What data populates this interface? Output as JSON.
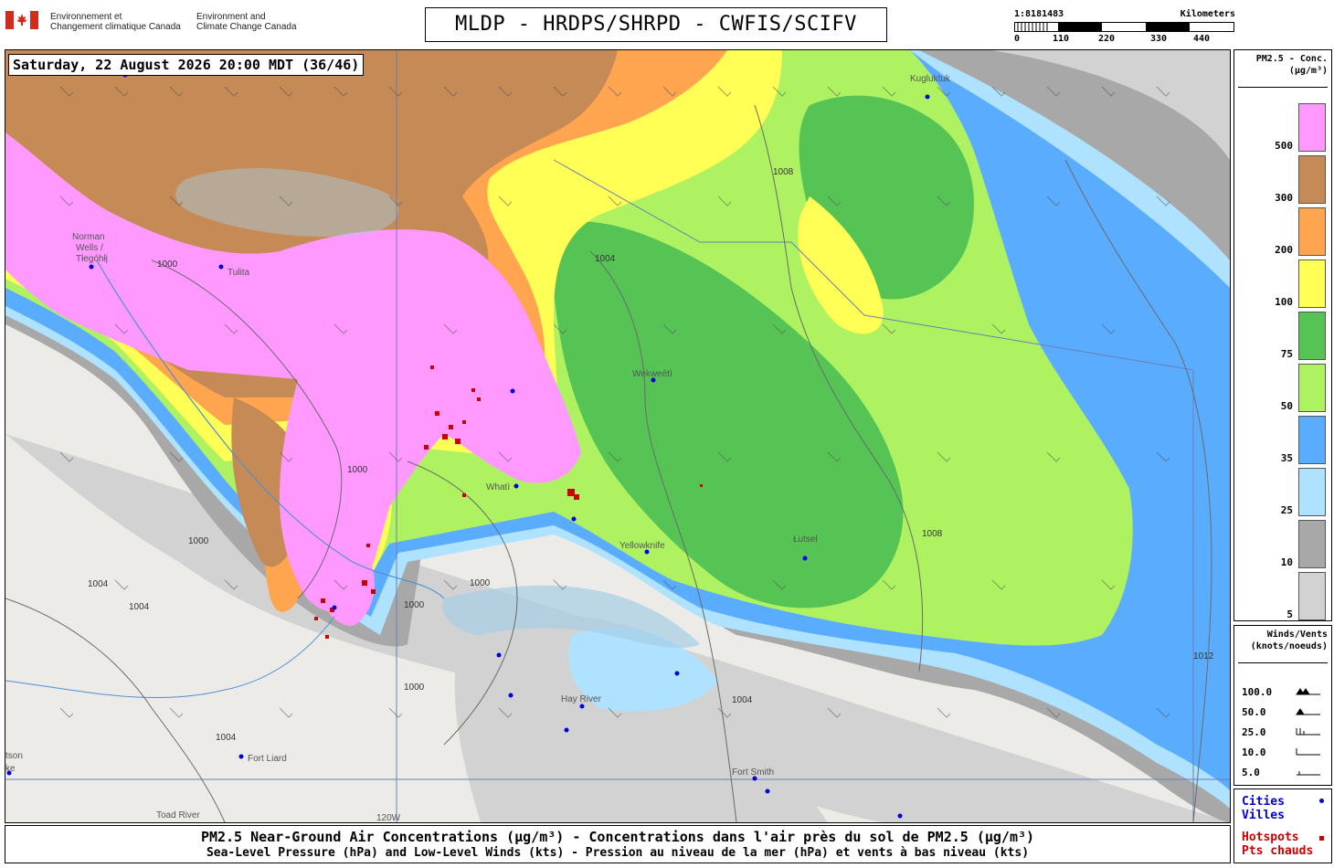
{
  "header": {
    "agency_fr_line1": "Environnement et",
    "agency_fr_line2": "Changement climatique Canada",
    "agency_en_line1": "Environment and",
    "agency_en_line2": "Climate Change Canada",
    "title": "MLDP - HRDPS/SHRPD - CWFIS/SCIFV"
  },
  "scale_bar": {
    "ratio": "1:8181483",
    "units": "Kilometers",
    "ticks": [
      "0",
      "110",
      "220",
      "330",
      "440"
    ]
  },
  "map": {
    "timestamp": "Saturday, 22 August 2026 20:00 MDT (36/46)",
    "places": {
      "norman_wells_1": "Norman",
      "norman_wells_2": "Wells /",
      "norman_wells_3": "Tłegóhłį",
      "tulita": "Tulita",
      "wekweeti": "Wekweètì",
      "whati": "Whatì",
      "yellowknife": "Yellowknife",
      "hay_river": "Hay River",
      "fort_liard": "Fort Liard",
      "fort_smith": "Fort Smith",
      "lutsel": "Łutsel",
      "toad_river": "Toad River",
      "kugluktuk": "Kugluktuk",
      "watson_lake_1": "tson",
      "watson_lake_2": "ke",
      "meridian": "120W"
    },
    "isobars": [
      "1000",
      "1004",
      "1008",
      "1012"
    ]
  },
  "legend": {
    "title_line1": "PM2.5 - Conc.",
    "title_line2": "(µg/m³)",
    "bins": [
      {
        "label": "500",
        "color": "#ff99ff"
      },
      {
        "label": "300",
        "color": "#c68a56"
      },
      {
        "label": "200",
        "color": "#ffa54f"
      },
      {
        "label": "100",
        "color": "#ffff55"
      },
      {
        "label": "75",
        "color": "#55c455"
      },
      {
        "label": "50",
        "color": "#aef262"
      },
      {
        "label": "35",
        "color": "#5aacff"
      },
      {
        "label": "25",
        "color": "#aee2ff"
      },
      {
        "label": "10",
        "color": "#a8a8a8"
      },
      {
        "label": "5",
        "color": "#d2d2d2"
      }
    ]
  },
  "wind_legend": {
    "title_line1": "Winds/Vents",
    "title_line2": "(knots/noeuds)",
    "rows": [
      "100.0",
      "50.0",
      "25.0",
      "10.0",
      "5.0"
    ]
  },
  "cities_legend": {
    "cities_en": "Cities",
    "cities_fr": "Villes",
    "hotspots_en": "Hotspots",
    "hotspots_fr": "Pts chauds",
    "city_color": "#0000dd",
    "hotspot_color": "#cc0000"
  },
  "footer": {
    "line1": "PM2.5 Near-Ground Air Concentrations (µg/m³) - Concentrations dans l'air près du sol de PM2.5 (µg/m³)",
    "line2": "Sea-Level Pressure (hPa) and Low-Level Winds (kts) - Pression au niveau de la mer (hPa) et vents à bas niveau (kts)"
  }
}
